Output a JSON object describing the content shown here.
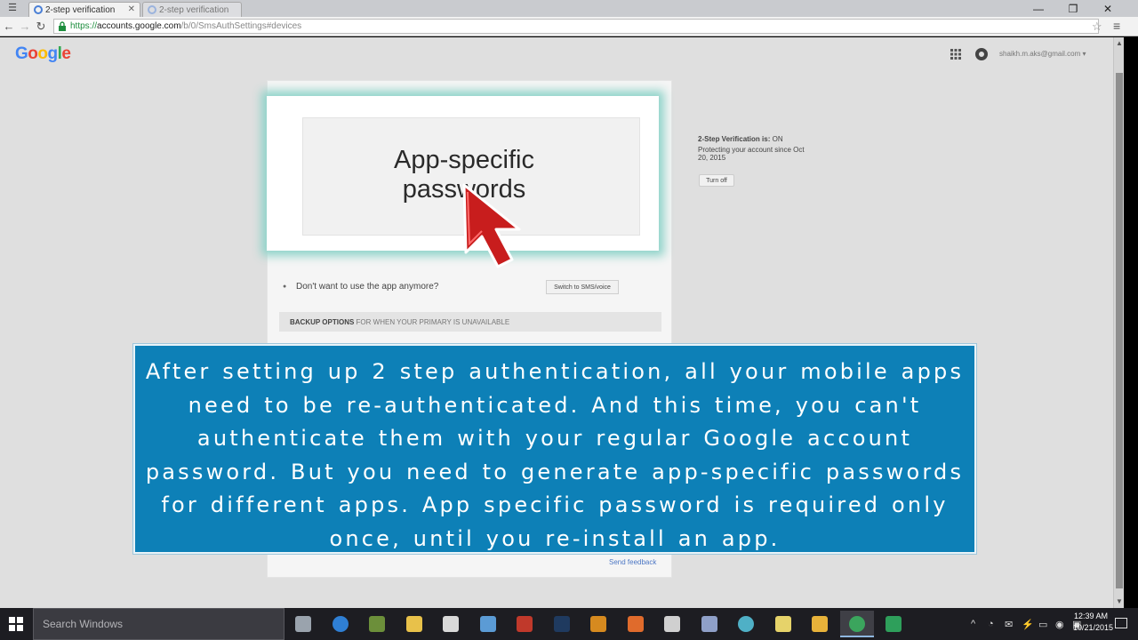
{
  "browser": {
    "tabs": [
      {
        "label": "2-step verification",
        "active": true
      },
      {
        "label": "2-step verification",
        "active": false
      }
    ],
    "url_scheme": "https://",
    "url_host": "accounts.google.com",
    "url_path": "/b/0/SmsAuthSettings#devices",
    "window_controls": {
      "minimize": "—",
      "maximize": "❐",
      "close": "✕"
    }
  },
  "google": {
    "logo_letters": [
      "G",
      "o",
      "o",
      "g",
      "l",
      "e"
    ],
    "account_email": "shaikh.m.aks@gmail.com ▾"
  },
  "zoom_panel": {
    "title_line1": "App-specific",
    "title_line2": "passwords"
  },
  "status": {
    "label": "2-Step Verification is:",
    "value": "ON",
    "protecting": "Protecting your account since Oct 20, 2015",
    "turn_off_button": "Turn off"
  },
  "app_row": {
    "question": "Don't want to use the app anymore?",
    "switch_button": "Switch to SMS/voice"
  },
  "backup": {
    "heading": "BACKUP OPTIONS",
    "subheading": "FOR WHEN YOUR PRIMARY IS UNAVAILABLE"
  },
  "footer": {
    "send_feedback": "Send feedback"
  },
  "caption": {
    "text": "After setting up 2 step authentication, all your mobile apps need to be re-authenticated. And this time, you can't authenticate them with your regular Google account password. But you need to generate app-specific passwords for different apps. App specific password is required only once, until you re-install an app."
  },
  "taskbar": {
    "search_placeholder": "Search Windows",
    "clock_time": "12:39 AM",
    "clock_date": "10/21/2015",
    "apps": [
      {
        "name": "task-view",
        "color": "#9aa3ad"
      },
      {
        "name": "edge",
        "color": "#2f7fd4"
      },
      {
        "name": "shortcut-a",
        "color": "#6c8f3a"
      },
      {
        "name": "file-explorer",
        "color": "#e8c14a"
      },
      {
        "name": "store",
        "color": "#d9d9d9"
      },
      {
        "name": "shortcut-b",
        "color": "#5b9bd5"
      },
      {
        "name": "shortcut-c",
        "color": "#c0392b"
      },
      {
        "name": "photoshop",
        "color": "#1f3a5f"
      },
      {
        "name": "shortcut-d",
        "color": "#d68a1f"
      },
      {
        "name": "shortcut-e",
        "color": "#e06b2c"
      },
      {
        "name": "shortcut-f",
        "color": "#d0d0d0"
      },
      {
        "name": "network-tool",
        "color": "#8fa0c8"
      },
      {
        "name": "shortcut-g",
        "color": "#4fb0c6"
      },
      {
        "name": "shortcut-h",
        "color": "#e6d36a"
      },
      {
        "name": "shortcut-i",
        "color": "#e8b23a"
      },
      {
        "name": "chrome",
        "color": "#3ba55d"
      },
      {
        "name": "shortcut-j",
        "color": "#2e9f5b"
      }
    ],
    "tray_icons": [
      "^",
      "◔",
      "✉",
      "⚡",
      "▭",
      "◉",
      "▣"
    ]
  }
}
